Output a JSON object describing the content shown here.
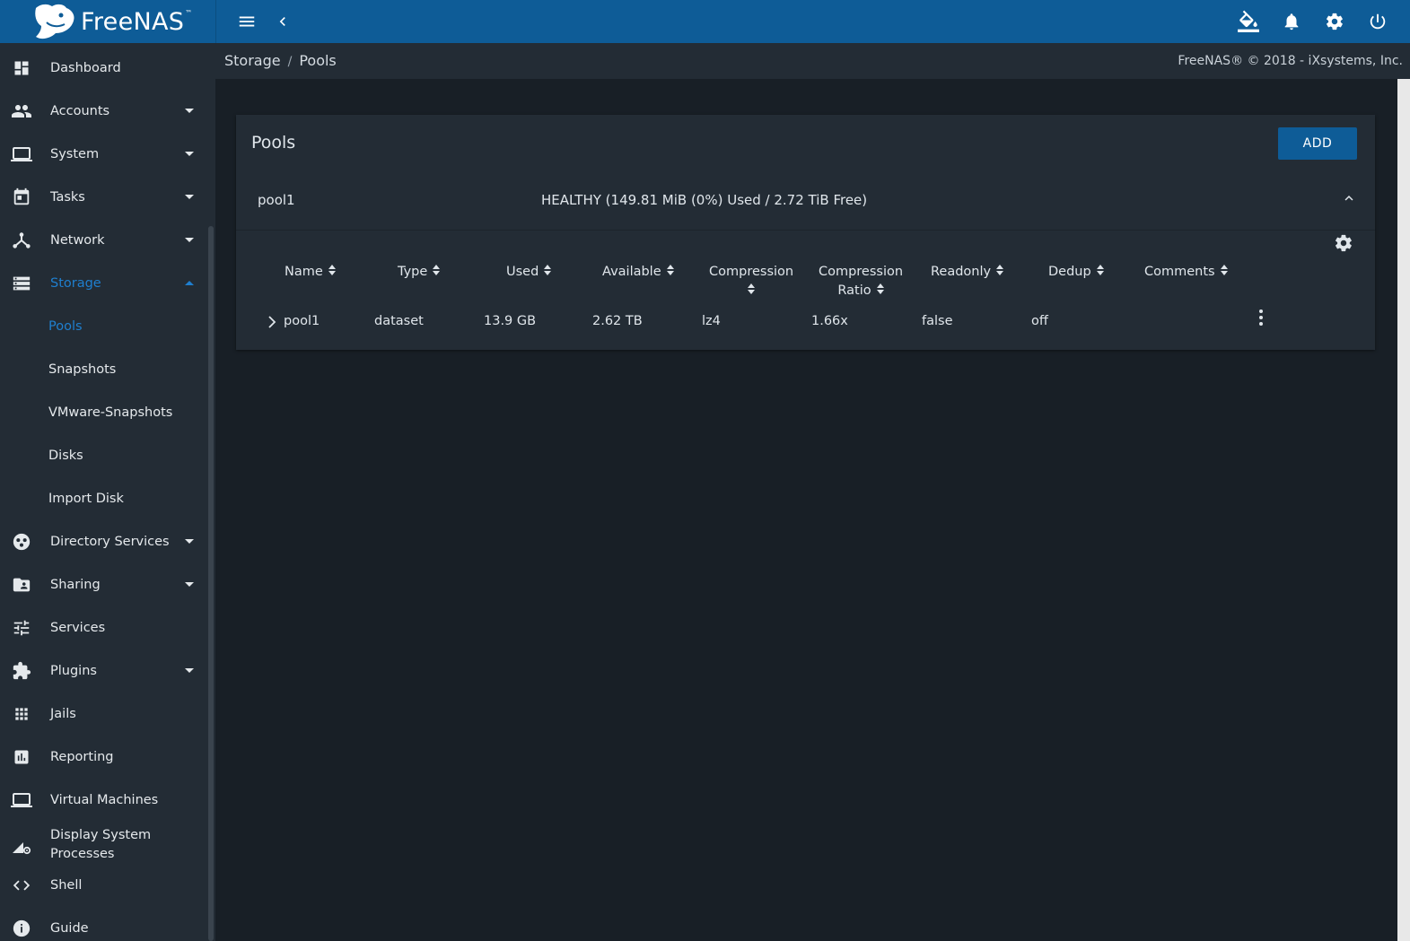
{
  "app": {
    "logo_text": "FreeNAS",
    "logo_tm": "™"
  },
  "topbar": {
    "left_icons": [
      "menu-icon",
      "chevron-left-icon"
    ],
    "right_icons": [
      "theme-bucket-icon",
      "bell-icon",
      "gear-icon",
      "power-icon"
    ]
  },
  "breadcrumb": {
    "items": [
      "Storage",
      "Pools"
    ],
    "separator": "/"
  },
  "copyright": "FreeNAS® © 2018 - iXsystems, Inc.",
  "sidebar": {
    "items": [
      {
        "label": "Dashboard",
        "icon": "dashboard-icon"
      },
      {
        "label": "Accounts",
        "icon": "people-icon",
        "caret": "down"
      },
      {
        "label": "System",
        "icon": "laptop-icon",
        "caret": "down"
      },
      {
        "label": "Tasks",
        "icon": "calendar-icon",
        "caret": "down"
      },
      {
        "label": "Network",
        "icon": "network-icon",
        "caret": "down"
      },
      {
        "label": "Storage",
        "icon": "storage-icon",
        "caret": "up",
        "active": true
      },
      {
        "label": "Directory Services",
        "icon": "directory-icon",
        "caret": "down"
      },
      {
        "label": "Sharing",
        "icon": "folder-shared-icon",
        "caret": "down"
      },
      {
        "label": "Services",
        "icon": "tune-icon"
      },
      {
        "label": "Plugins",
        "icon": "puzzle-icon",
        "caret": "down"
      },
      {
        "label": "Jails",
        "icon": "apps-icon"
      },
      {
        "label": "Reporting",
        "icon": "chart-icon"
      },
      {
        "label": "Virtual Machines",
        "icon": "computer-icon"
      },
      {
        "label": "Display System Processes",
        "icon": "processes-icon"
      },
      {
        "label": "Shell",
        "icon": "code-icon"
      },
      {
        "label": "Guide",
        "icon": "info-icon"
      }
    ],
    "storage_subitems": [
      {
        "label": "Pools",
        "active": true
      },
      {
        "label": "Snapshots"
      },
      {
        "label": "VMware-Snapshots"
      },
      {
        "label": "Disks"
      },
      {
        "label": "Import Disk"
      }
    ]
  },
  "card": {
    "title": "Pools",
    "add_label": "ADD",
    "pool": {
      "name": "pool1",
      "status": "HEALTHY (149.81 MiB (0%) Used / 2.72 TiB Free)"
    },
    "table": {
      "headers": [
        "Name",
        "Type",
        "Used",
        "Available",
        "Compression",
        "Compression Ratio",
        "Readonly",
        "Dedup",
        "Comments"
      ],
      "rows": [
        {
          "name": "pool1",
          "type": "dataset",
          "used": "13.9 GB",
          "available": "2.62 TB",
          "compression": "lz4",
          "compression_ratio": "1.66x",
          "readonly": "false",
          "dedup": "off",
          "comments": ""
        }
      ]
    }
  },
  "colors": {
    "topbar": "#0e5c97",
    "sidebar": "#232c35",
    "background": "#181f26",
    "accent": "#1f7fcf"
  }
}
